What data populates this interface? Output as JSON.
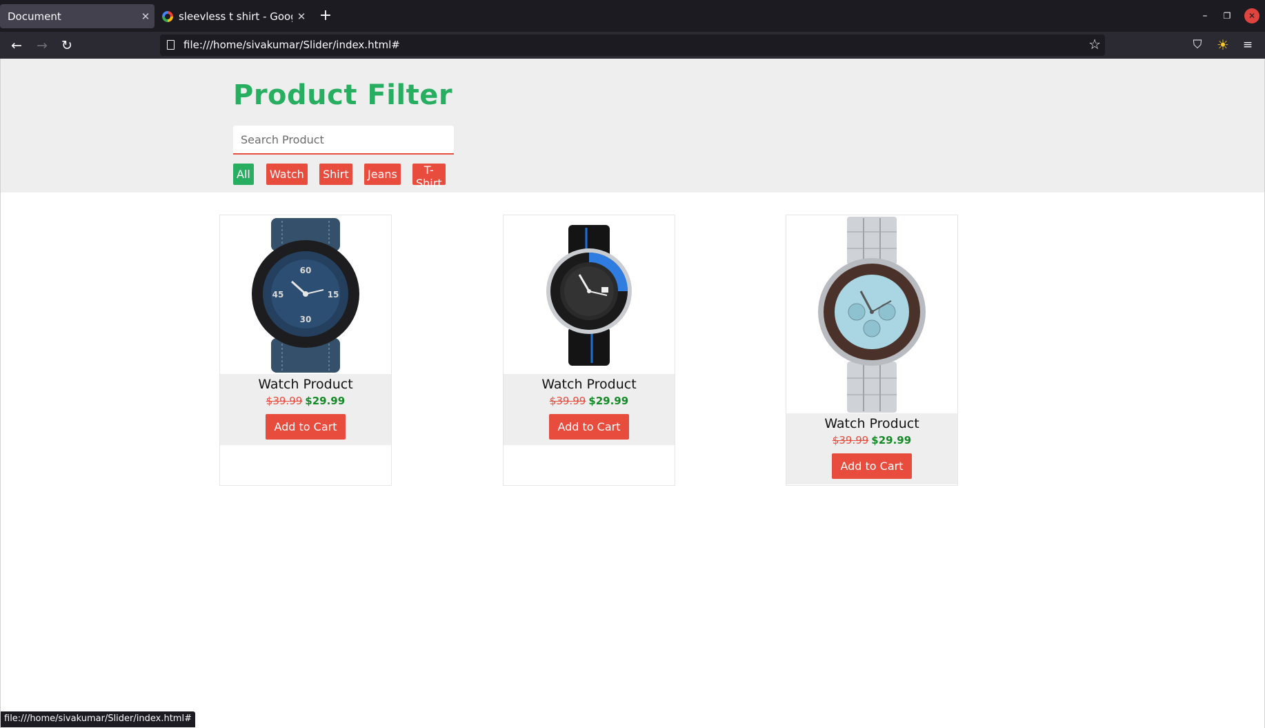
{
  "browser": {
    "tabs": [
      {
        "title": "Document",
        "active": true
      },
      {
        "title": "sleevless t shirt - Google",
        "active": false
      }
    ],
    "new_tab_symbol": "+",
    "url": "file:///home/sivakumar/Slider/index.html#",
    "status_url": "file:///home/sivakumar/Slider/index.html#"
  },
  "page": {
    "title": "Product Filter",
    "search_placeholder": "Search Product",
    "filters": [
      "All",
      "Watch",
      "Shirt",
      "Jeans",
      "T-Shirt"
    ],
    "active_filter": "All"
  },
  "products": [
    {
      "name": "Watch Product",
      "old_price": "$39.99",
      "new_price": "$29.99",
      "cart_label": "Add to Cart",
      "image_icon": "watch-black-blue-icon"
    },
    {
      "name": "Watch Product",
      "old_price": "$39.99",
      "new_price": "$29.99",
      "cart_label": "Add to Cart",
      "image_icon": "watch-diver-icon"
    },
    {
      "name": "Watch Product",
      "old_price": "$39.99",
      "new_price": "$29.99",
      "cart_label": "Add to Cart",
      "image_icon": "watch-chronograph-icon"
    }
  ],
  "colors": {
    "accent_green": "#27ae60",
    "accent_red": "#e74c3c",
    "price_green": "#138a25"
  }
}
